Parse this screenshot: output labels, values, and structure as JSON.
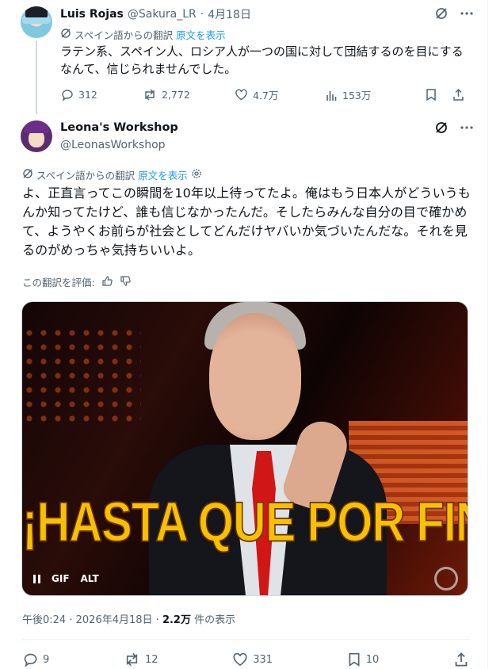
{
  "parent": {
    "name": "Luis Rojas",
    "handle": "@Sakura_LR",
    "dot": "·",
    "date": "4月18日",
    "translation_note": "スペイン語からの翻訳",
    "show_original": "原文を表示",
    "text": "ラテン系、スペイン人、ロシア人が一つの国に対して団結するのを目にするなんて、信じられませんでした。",
    "stats": {
      "replies": "312",
      "retweets": "2,772",
      "likes": "4.7万",
      "views": "153万"
    }
  },
  "main": {
    "name": "Leona's Workshop",
    "handle": "@LeonasWorkshop",
    "translation_note": "スペイン語からの翻訳",
    "show_original": "原文を表示",
    "text": "よ、正直言ってこの瞬間を10年以上待ってたよ。俺はもう日本人がどういうもんか知ってたけど、誰も信じなかったんだ。そしたらみんな自分の目で確かめて、ようやくお前らが社会としてどんだけヤバいか気づいたんだな。それを見るのがめっちゃ気持ちいいよ。",
    "rate_label": "この翻訳を評価:",
    "media": {
      "caption": "¡HASTA QUE POR FIN!",
      "gif_label": "GIF",
      "alt_label": "ALT"
    },
    "time": "午後0:24",
    "dot": "·",
    "date": "2026年4月18日",
    "views_count": "2.2万",
    "views_label": "件の表示",
    "stats": {
      "replies": "9",
      "retweets": "12",
      "likes": "331",
      "bookmarks": "10"
    }
  }
}
